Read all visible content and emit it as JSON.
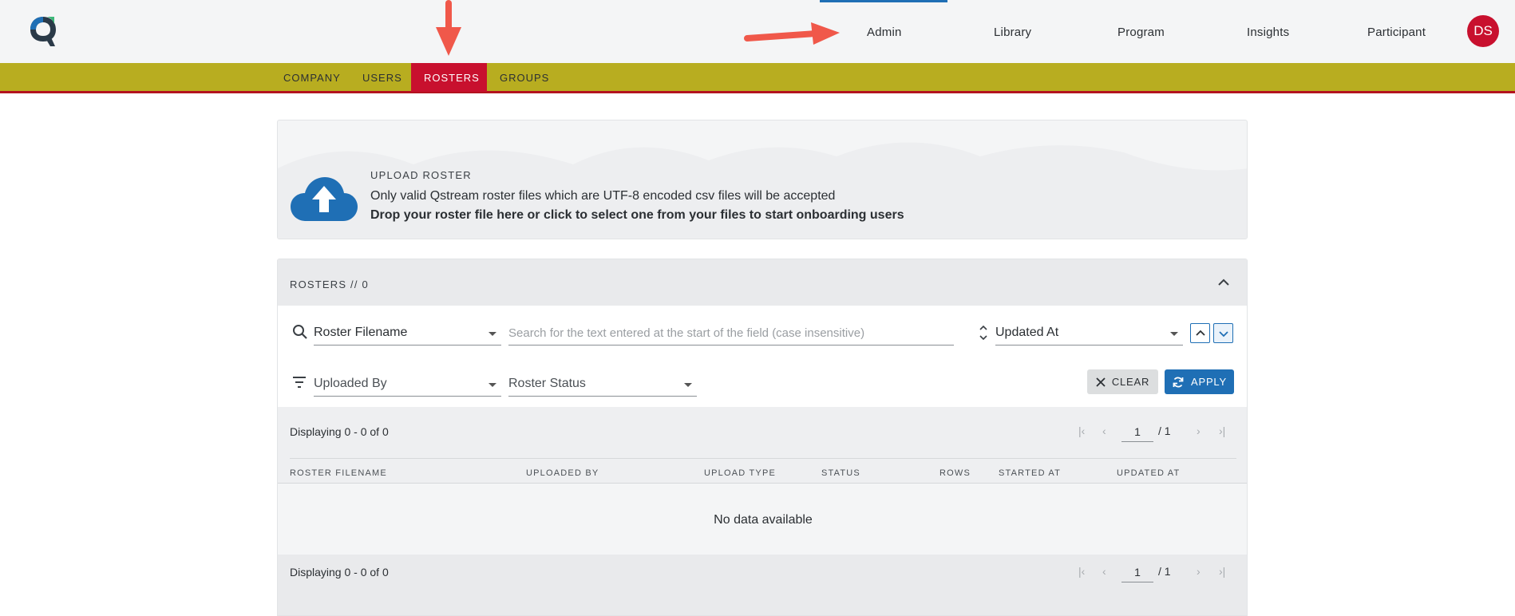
{
  "topnav": {
    "items": [
      {
        "label": "Admin"
      },
      {
        "label": "Library"
      },
      {
        "label": "Program"
      },
      {
        "label": "Insights"
      },
      {
        "label": "Participant"
      }
    ],
    "avatar_initials": "DS",
    "active": "Admin"
  },
  "subnav": {
    "tabs": [
      {
        "label": "COMPANY"
      },
      {
        "label": "USERS"
      },
      {
        "label": "ROSTERS"
      },
      {
        "label": "GROUPS"
      }
    ],
    "active": "ROSTERS"
  },
  "upload": {
    "title": "UPLOAD ROSTER",
    "line1": "Only valid Qstream roster files which are UTF-8 encoded csv files will be accepted",
    "line2": "Drop your roster file here or click to select one from your files to start onboarding users"
  },
  "rosters": {
    "title": "ROSTERS // 0",
    "search_field": "Roster Filename",
    "search_placeholder": "Search for the text entered at the start of the field (case insensitive)",
    "sort_field": "Updated At",
    "filter_uploaded_by": "Uploaded By",
    "filter_status": "Roster Status",
    "clear_label": "CLEAR",
    "apply_label": "APPLY",
    "displaying": "Displaying 0 - 0 of 0",
    "page": "1",
    "page_total": "/ 1",
    "columns": [
      "ROSTER FILENAME",
      "UPLOADED BY",
      "UPLOAD TYPE",
      "STATUS",
      "ROWS",
      "STARTED AT",
      "UPDATED AT"
    ],
    "empty_text": "No data available"
  },
  "colors": {
    "accent": "#1f6fb5",
    "brand_red": "#c8102e",
    "subnav_bg": "#b8ad20",
    "arrow": "#f0584a"
  }
}
